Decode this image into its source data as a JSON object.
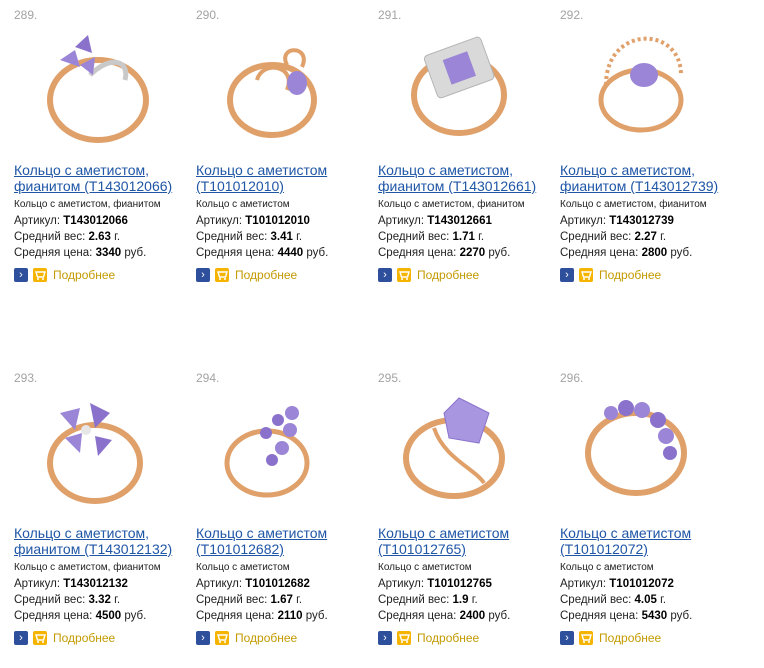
{
  "ui": {
    "currency": "руб.",
    "more_label": "Подробнее"
  },
  "products": [
    {
      "num": "289.",
      "title": "Кольцо с аметистом, фианитом (Т143012066)",
      "desc": "Кольцо с аметистом, фианитом",
      "article_label": "Артикул:",
      "article": "Т143012066",
      "weight_label": "Средний вес:",
      "weight": "2.63",
      "weight_unit": "г.",
      "price_label": "Средняя цена:",
      "price": "3340",
      "currency": "руб.",
      "more": "Подробнее"
    },
    {
      "num": "290.",
      "title": "Кольцо с аметистом (Т101012010)",
      "desc": "Кольцо с аметистом",
      "article_label": "Артикул:",
      "article": "Т101012010",
      "weight_label": "Средний вес:",
      "weight": "3.41",
      "weight_unit": "г.",
      "price_label": "Средняя цена:",
      "price": "4440",
      "currency": "руб.",
      "more": "Подробнее"
    },
    {
      "num": "291.",
      "title": "Кольцо с аметистом, фианитом (Т143012661)",
      "desc": "Кольцо с аметистом, фианитом",
      "article_label": "Артикул:",
      "article": "Т143012661",
      "weight_label": "Средний вес:",
      "weight": "1.71",
      "weight_unit": "г.",
      "price_label": "Средняя цена:",
      "price": "2270",
      "currency": "руб.",
      "more": "Подробнее"
    },
    {
      "num": "292.",
      "title": "Кольцо с аметистом, фианитом (Т143012739)",
      "desc": "Кольцо с аметистом, фианитом",
      "article_label": "Артикул:",
      "article": "Т143012739",
      "weight_label": "Средний вес:",
      "weight": "2.27",
      "weight_unit": "г.",
      "price_label": "Средняя цена:",
      "price": "2800",
      "currency": "руб.",
      "more": "Подробнее"
    },
    {
      "num": "293.",
      "title": "Кольцо с аметистом, фианитом (Т143012132)",
      "desc": "Кольцо с аметистом, фианитом",
      "article_label": "Артикул:",
      "article": "Т143012132",
      "weight_label": "Средний вес:",
      "weight": "3.32",
      "weight_unit": "г.",
      "price_label": "Средняя цена:",
      "price": "4500",
      "currency": "руб.",
      "more": "Подробнее"
    },
    {
      "num": "294.",
      "title": "Кольцо с аметистом (Т101012682)",
      "desc": "Кольцо с аметистом",
      "article_label": "Артикул:",
      "article": "Т101012682",
      "weight_label": "Средний вес:",
      "weight": "1.67",
      "weight_unit": "г.",
      "price_label": "Средняя цена:",
      "price": "2110",
      "currency": "руб.",
      "more": "Подробнее"
    },
    {
      "num": "295.",
      "title": "Кольцо с аметистом (Т101012765)",
      "desc": "Кольцо с аметистом",
      "article_label": "Артикул:",
      "article": "Т101012765",
      "weight_label": "Средний вес:",
      "weight": "1.9",
      "weight_unit": "г.",
      "price_label": "Средняя цена:",
      "price": "2400",
      "currency": "руб.",
      "more": "Подробнее"
    },
    {
      "num": "296.",
      "title": "Кольцо с аметистом (Т101012072)",
      "desc": "Кольцо с аметистом",
      "article_label": "Артикул:",
      "article": "Т101012072",
      "weight_label": "Средний вес:",
      "weight": "4.05",
      "weight_unit": "г.",
      "price_label": "Средняя цена:",
      "price": "5430",
      "currency": "руб.",
      "more": "Подробнее"
    }
  ],
  "colors": {
    "link": "#1f56a6",
    "more": "#c39a00",
    "gold": "#e0a06a",
    "amethyst": "#9b85d6",
    "arrow_btn": "#2e4f9c",
    "cart_btn": "#f5b400"
  },
  "icons": {
    "arrow": "arrow-right-icon",
    "cart": "cart-icon",
    "ring": "ring-photo"
  }
}
